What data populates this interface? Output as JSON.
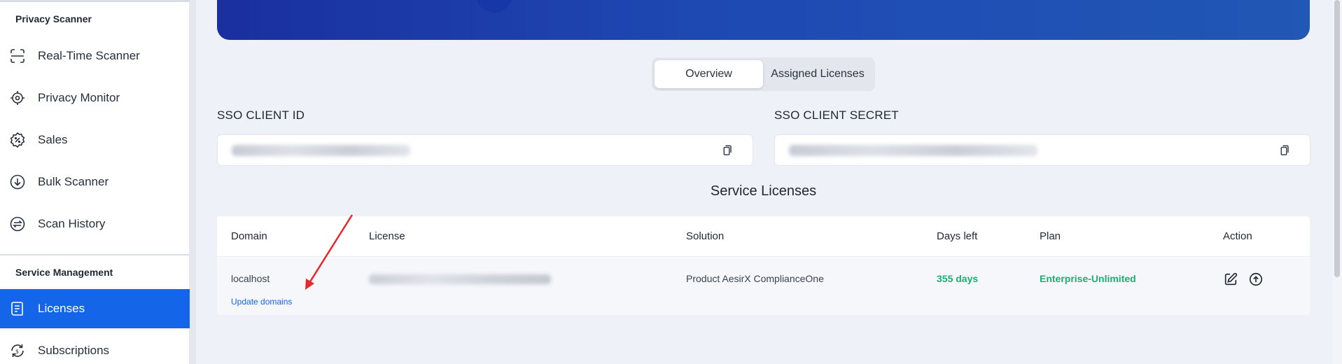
{
  "sidebar": {
    "section1": "Privacy Scanner",
    "items1": [
      {
        "label": "Real-Time Scanner",
        "icon": "scan-icon"
      },
      {
        "label": "Privacy Monitor",
        "icon": "monitor-icon"
      },
      {
        "label": "Sales",
        "icon": "discount-icon"
      },
      {
        "label": "Bulk Scanner",
        "icon": "download-circle-icon"
      },
      {
        "label": "Scan History",
        "icon": "history-icon"
      }
    ],
    "section2": "Service Management",
    "items2": [
      {
        "label": "Licenses",
        "icon": "license-icon",
        "active": true
      },
      {
        "label": "Subscriptions",
        "icon": "subscription-icon"
      }
    ]
  },
  "tabs": {
    "overview": "Overview",
    "assigned": "Assigned Licenses"
  },
  "sso": {
    "client_id_label": "SSO CLIENT ID",
    "client_secret_label": "SSO CLIENT SECRET"
  },
  "licenses": {
    "heading": "Service Licenses",
    "columns": [
      "Domain",
      "License",
      "Solution",
      "Days left",
      "Plan",
      "Action"
    ],
    "rows": [
      {
        "domain": "localhost",
        "update_link": "Update domains",
        "solution": "Product AesirX ComplianceOne",
        "days_left": "355 days",
        "plan": "Enterprise-Unlimited"
      }
    ]
  },
  "colors": {
    "accent": "#1565e8",
    "success": "#19b071",
    "annotation": "#e8262b"
  }
}
